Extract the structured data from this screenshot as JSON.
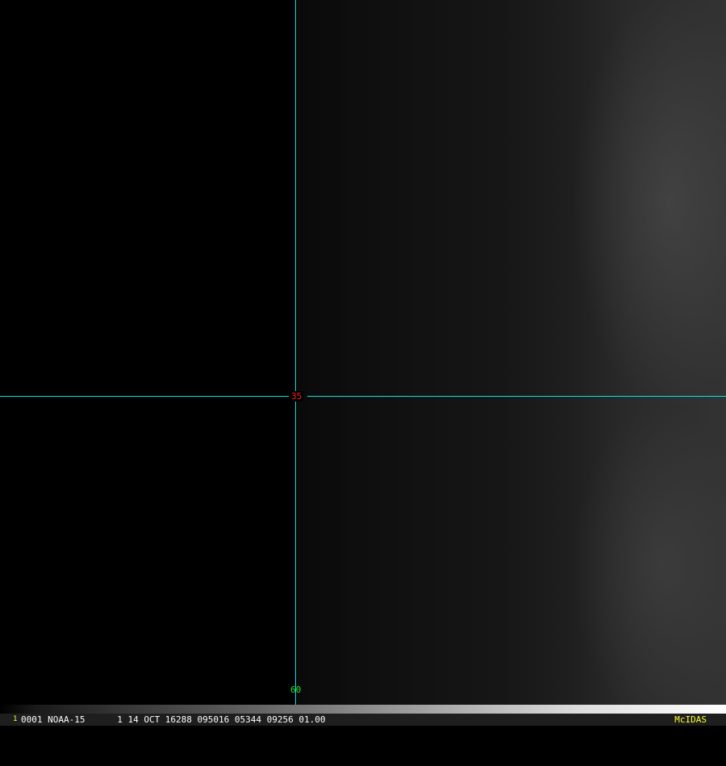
{
  "image": {
    "description_colors": {
      "grid": "#00e5e5",
      "lat_label": "#ff1a1a",
      "lon_label": "#2bdc2b",
      "brand": "#ffff33"
    }
  },
  "grid_labels": {
    "latitude": "35",
    "longitude": "60"
  },
  "status_bar": {
    "frame_number": "1",
    "info": "0001 NOAA-15      1 14 OCT 16288 095016 05344 09256 01.00",
    "brand": "McIDAS"
  }
}
